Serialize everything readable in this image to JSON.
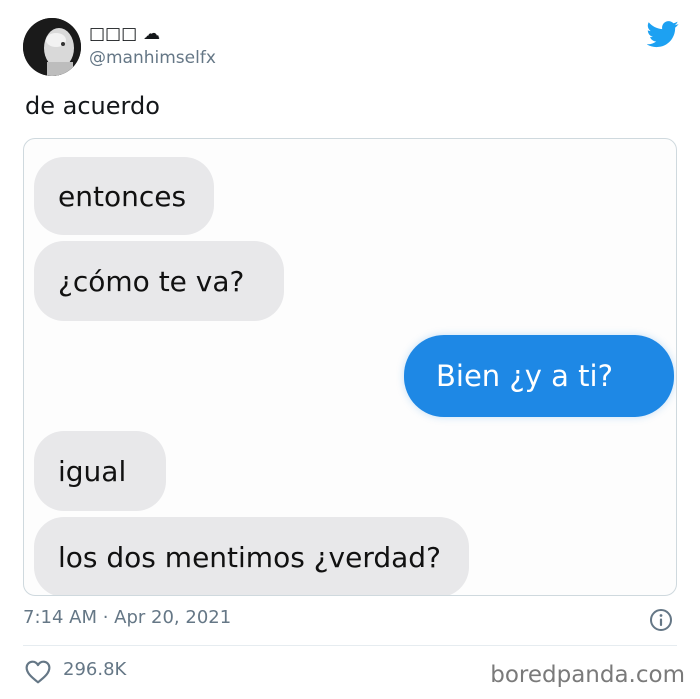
{
  "user": {
    "display_name": "□□□ ☁",
    "handle": "@manhimselfx"
  },
  "tweet": {
    "text": "de acuerdo",
    "timestamp": "7:14 AM · Apr 20, 2021"
  },
  "chat": {
    "messages": [
      {
        "direction": "incoming",
        "text": "entonces"
      },
      {
        "direction": "incoming",
        "text": "¿cómo te va?"
      },
      {
        "direction": "outgoing",
        "text": "Bien ¿y a ti?"
      },
      {
        "direction": "incoming",
        "text": "igual"
      },
      {
        "direction": "incoming",
        "text": "los dos mentimos ¿verdad?"
      }
    ]
  },
  "stats": {
    "likes": "296.8K"
  },
  "watermark": "boredpanda.com",
  "colors": {
    "twitter_blue": "#1da1f2",
    "bubble_blue": "#1e88e5",
    "bubble_gray": "#e8e8ea",
    "muted_text": "#657786"
  },
  "icons": {
    "logo": "twitter-bird-icon",
    "info": "info-icon",
    "like": "heart-icon"
  }
}
